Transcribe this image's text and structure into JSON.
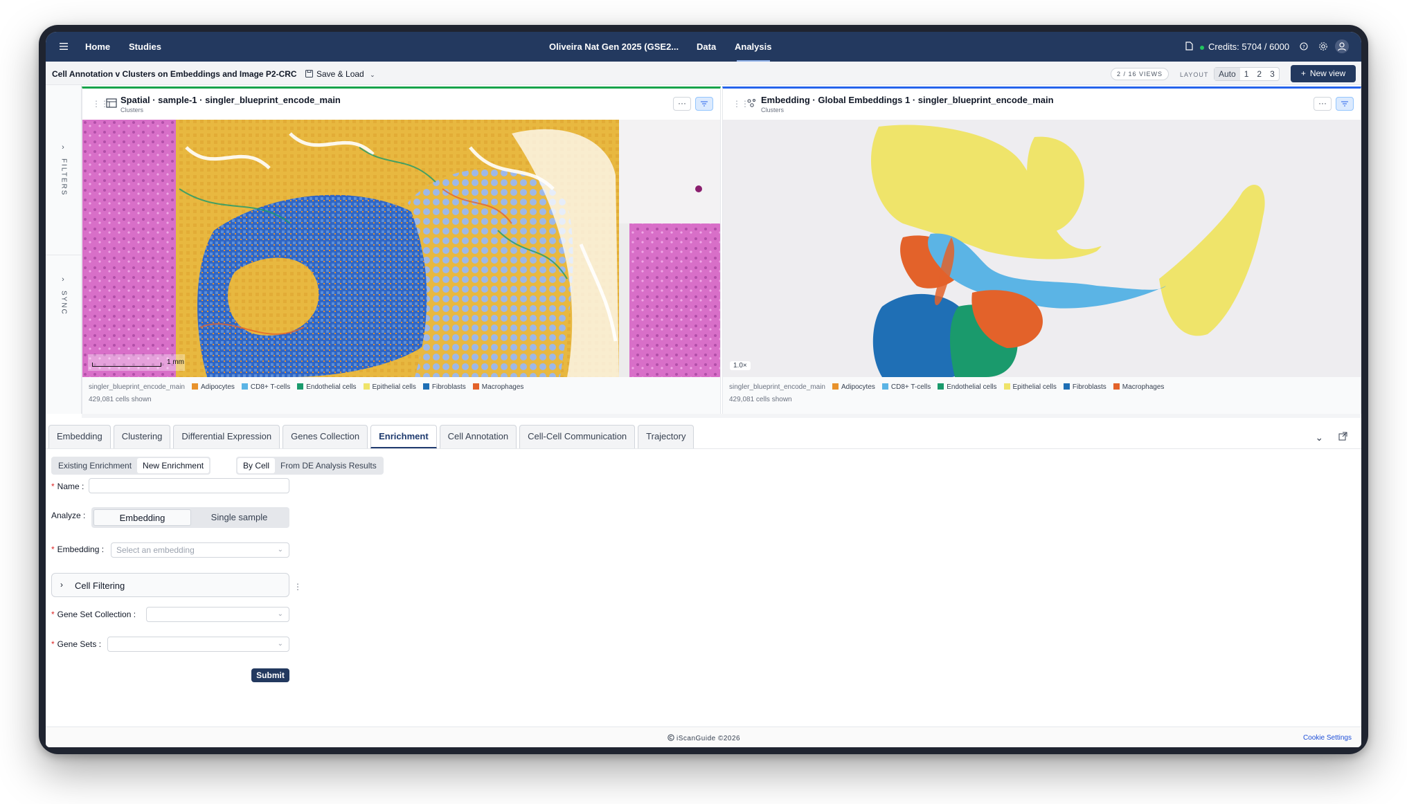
{
  "topbar": {
    "home": "Home",
    "studies": "Studies",
    "study_title": "Oliveira Nat Gen 2025 (GSE2...",
    "data": "Data",
    "analysis": "Analysis",
    "credits": "Credits: 5704 / 6000"
  },
  "subheader": {
    "title": "Cell Annotation v Clusters on Embeddings and Image P2-CRC",
    "save_load": "Save & Load",
    "views": "2 / 16 VIEWS",
    "layout_label": "LAYOUT",
    "layout_options": [
      "Auto",
      "1",
      "2",
      "3"
    ],
    "new_view": "New view"
  },
  "rail": {
    "filters": "FILTERS",
    "sync": "SYNC"
  },
  "panels": {
    "spatial": {
      "title": "Spatial · sample-1 · singler_blueprint_encode_main",
      "subtitle": "Clusters",
      "scale": "1 mm",
      "legend_source": "singler_blueprint_encode_main",
      "cells_shown": "429,081 cells shown"
    },
    "embedding": {
      "title": "Embedding · Global Embeddings 1 · singler_blueprint_encode_main",
      "subtitle": "Clusters",
      "zoom": "1.0×",
      "legend_source": "singler_blueprint_encode_main",
      "cells_shown": "429,081 cells shown"
    }
  },
  "legend_items": [
    {
      "label": "Adipocytes",
      "color": "#e8922c"
    },
    {
      "label": "CD8+ T-cells",
      "color": "#5bb4e5"
    },
    {
      "label": "Endothelial cells",
      "color": "#1a9a6c"
    },
    {
      "label": "Epithelial cells",
      "color": "#efe46a"
    },
    {
      "label": "Fibroblasts",
      "color": "#1f6fb5"
    },
    {
      "label": "Macrophages",
      "color": "#e3622a"
    }
  ],
  "tabs": [
    "Embedding",
    "Clustering",
    "Differential Expression",
    "Genes Collection",
    "Enrichment",
    "Cell Annotation",
    "Cell-Cell Communication",
    "Trajectory"
  ],
  "enrichment": {
    "mode": [
      "Existing Enrichment",
      "New Enrichment"
    ],
    "source": [
      "By Cell",
      "From DE Analysis Results"
    ],
    "name_label": "Name",
    "analyze_label": "Analyze",
    "analyze_options": [
      "Embedding",
      "Single sample"
    ],
    "embedding_label": "Embedding",
    "embedding_placeholder": "Select an embedding",
    "cell_filtering": "Cell Filtering",
    "gene_set_collection_label": "Gene Set Collection",
    "gene_sets_label": "Gene Sets",
    "submit": "Submit"
  },
  "footer": {
    "copyright": "iScanGuide ©2026",
    "cookie": "Cookie Settings"
  }
}
